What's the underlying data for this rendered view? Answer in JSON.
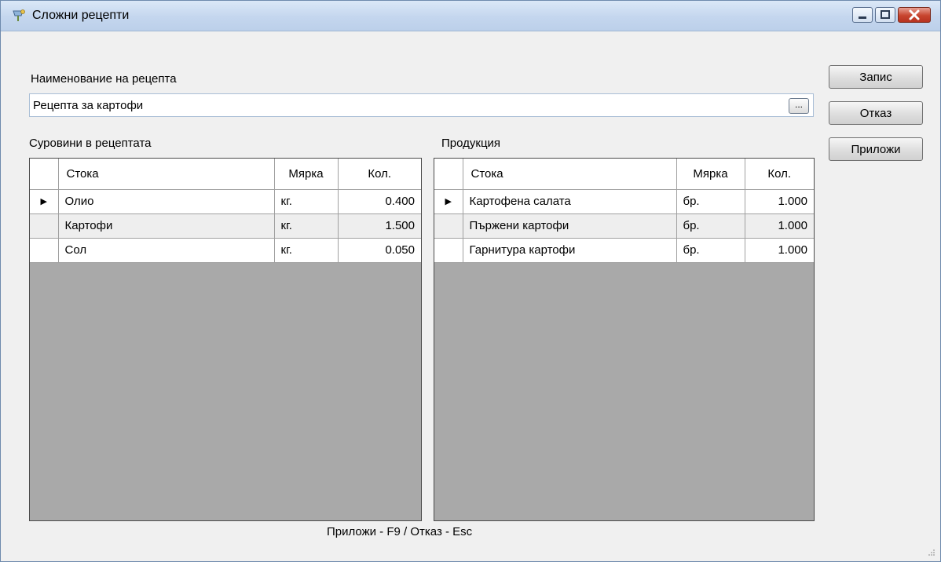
{
  "window": {
    "title": "Сложни рецепти",
    "minimize_icon": "minimize-icon",
    "maximize_icon": "maximize-icon",
    "close_icon": "close-icon"
  },
  "form": {
    "name_label": "Наименование на рецепта",
    "name_value": "Рецепта за картофи",
    "browse_label": "...",
    "ingredients_label": "Суровини в рецептата",
    "products_label": "Продукция"
  },
  "buttons": {
    "save": "Запис",
    "cancel": "Отказ",
    "apply": "Приложи"
  },
  "ingredients": {
    "headers": [
      "Стока",
      "Мярка",
      "Кол."
    ],
    "rows": [
      {
        "item": "Олио",
        "unit": "кг.",
        "qty": "0.400",
        "current": true
      },
      {
        "item": "Картофи",
        "unit": "кг.",
        "qty": "1.500",
        "current": false
      },
      {
        "item": "Сол",
        "unit": "кг.",
        "qty": "0.050",
        "current": false
      }
    ]
  },
  "products": {
    "headers": [
      "Стока",
      "Мярка",
      "Кол."
    ],
    "rows": [
      {
        "item": "Картофена салата",
        "unit": "бр.",
        "qty": "1.000",
        "current": true
      },
      {
        "item": "Пържени картофи",
        "unit": "бр.",
        "qty": "1.000",
        "current": false
      },
      {
        "item": "Гарнитура картофи",
        "unit": "бр.",
        "qty": "1.000",
        "current": false
      }
    ]
  },
  "row_pointer": "▶",
  "footer": "Приложи - F9 / Отказ - Esc",
  "colors": {
    "grid_empty": "#a9a9a9",
    "title_bar": "#c4d6ee",
    "close_button": "#c7442e"
  }
}
